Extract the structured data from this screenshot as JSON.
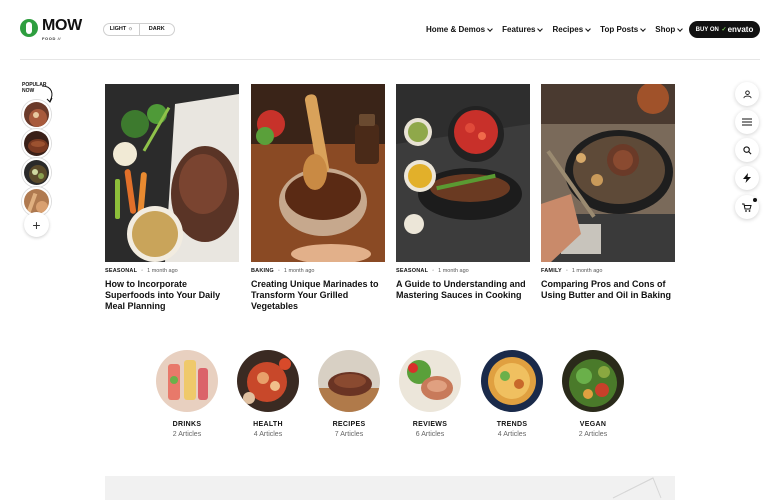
{
  "header": {
    "logo_text": "MOW",
    "logo_sub": "FOOD //",
    "theme": {
      "light_label": "LIGHT ☼",
      "dark_label": "DARK"
    },
    "nav": [
      {
        "label": "Home & Demos"
      },
      {
        "label": "Features"
      },
      {
        "label": "Recipes"
      },
      {
        "label": "Top Posts"
      },
      {
        "label": "Shop"
      }
    ],
    "buy": {
      "prefix": "BUY ON",
      "brand": "envato"
    }
  },
  "popular": {
    "label": "POPULAR NOW",
    "add_glyph": "+"
  },
  "rail": {
    "icons": [
      "user-icon",
      "menu-icon",
      "search-icon",
      "bolt-icon",
      "cart-icon"
    ]
  },
  "articles": [
    {
      "category": "SEASONAL",
      "time": "1 month ago",
      "title": "How to Incorporate Superfoods into Your Daily Meal Planning"
    },
    {
      "category": "BAKING",
      "time": "1 month ago",
      "title": "Creating Unique Marinades to Transform Your Grilled Vegetables"
    },
    {
      "category": "SEASONAL",
      "time": "1 month ago",
      "title": "A Guide to Understanding and Mastering Sauces in Cooking"
    },
    {
      "category": "FAMILY",
      "time": "1 month ago",
      "title": "Comparing Pros and Cons of Using Butter and Oil in Baking"
    }
  ],
  "categories": [
    {
      "name": "DRINKS",
      "count": "2 Articles"
    },
    {
      "name": "HEALTH",
      "count": "4 Articles"
    },
    {
      "name": "RECIPES",
      "count": "7 Articles"
    },
    {
      "name": "REVIEWS",
      "count": "6 Articles"
    },
    {
      "name": "TRENDS",
      "count": "4 Articles"
    },
    {
      "name": "VEGAN",
      "count": "2 Articles"
    }
  ],
  "colors": {
    "brand": "#2e9e3f",
    "text": "#111111",
    "muted": "#666666"
  }
}
